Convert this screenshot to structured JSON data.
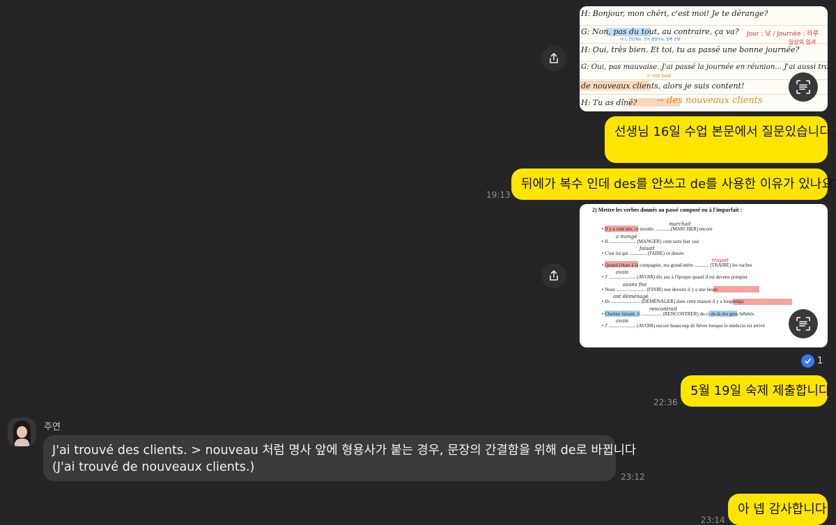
{
  "chat": {
    "messages": [
      {
        "text": "선생님 16일 수업 본문에서 질문있습니다."
      },
      {
        "text": "뒤에가 복수 인데 des를 안쓰고 de를 사용한 이유가 있나요?",
        "time": "19:13"
      },
      {
        "text": "5월 19일 숙제 제출합니다",
        "time": "22:36",
        "read_count": "1"
      },
      {
        "sender": "주연",
        "line1": "J'ai trouvé des clients. > nouveau 처럼 명사 앞에 형용사가 붙는 경우, 문장의 간결함을 위해 de로 바뀝니다",
        "line2": "(J'ai trouvé de nouveaux clients.)",
        "time": "23:12"
      },
      {
        "text": "아 넵 감사합니다",
        "time": "23:14"
      }
    ]
  },
  "image1": {
    "lines": [
      "H: Bonjour, mon chéri, c'est moi! Je te dérange?",
      "G: Non, pas du tout, au contraire, ça va?",
      "H: Oui, très bien. Et toi, tu as passé une bonne journée?",
      "G: Oui, pas mauvaise. J'ai passé la journée en réunion... J'ai aussi trouvé",
      "de nouveaux clients, alors je suis content!",
      "H: Tu as dîné?"
    ],
    "notes": {
      "jour": "Jour : 낮 / Journée : 하루",
      "jour_sub": "일상의 일과",
      "not_bad": "= not bad",
      "arrow": "→ des nouveaux clients",
      "blue_small": "아니, 천만에요, 전혀 괜찮아요, 방해 안돼"
    }
  },
  "image2": {
    "title_num": "2)",
    "title": "Mettre les verbes donnés au passé composé ou à l'imparfait :",
    "rows": [
      {
        "text": "• Il y a cent ans, ce moulin .............(MARCHER) encore",
        "hw": "marchait"
      },
      {
        "text": "• Il ...................... (MANGER) cette tarte hier soir",
        "hw": "a mangé"
      },
      {
        "text": "• C'est lui qui .............. (FAIRE) ce dessin",
        "hw": "faisait"
      },
      {
        "text": "• Quand j'étais à la compagnie, ma grand-mère ............ (TRAIRE) les vaches",
        "hw": "trayait"
      },
      {
        "text": "• J' ...................... (AVOIR) dix ans à l'époque quand il est devenu pompier",
        "hw": "avais"
      },
      {
        "text": "• Nous ........................ (FINIR) nos devoirs il y a une heure",
        "hw": "avons fini"
      },
      {
        "text": "• Ils ........................ (DÉMÉNAGER) dans cette maison il y a longtemps",
        "hw": "ont déménagé"
      },
      {
        "text": "• Chemin faisant, il ................. (RENCONTRER) de-ci de-là des gens hébétés",
        "hw": "rencontrait"
      },
      {
        "text": "• J' ...................... (AVOIR) encore beaucoup de fièvre lorsque le médecin est arrivé",
        "hw": "avais"
      }
    ]
  }
}
